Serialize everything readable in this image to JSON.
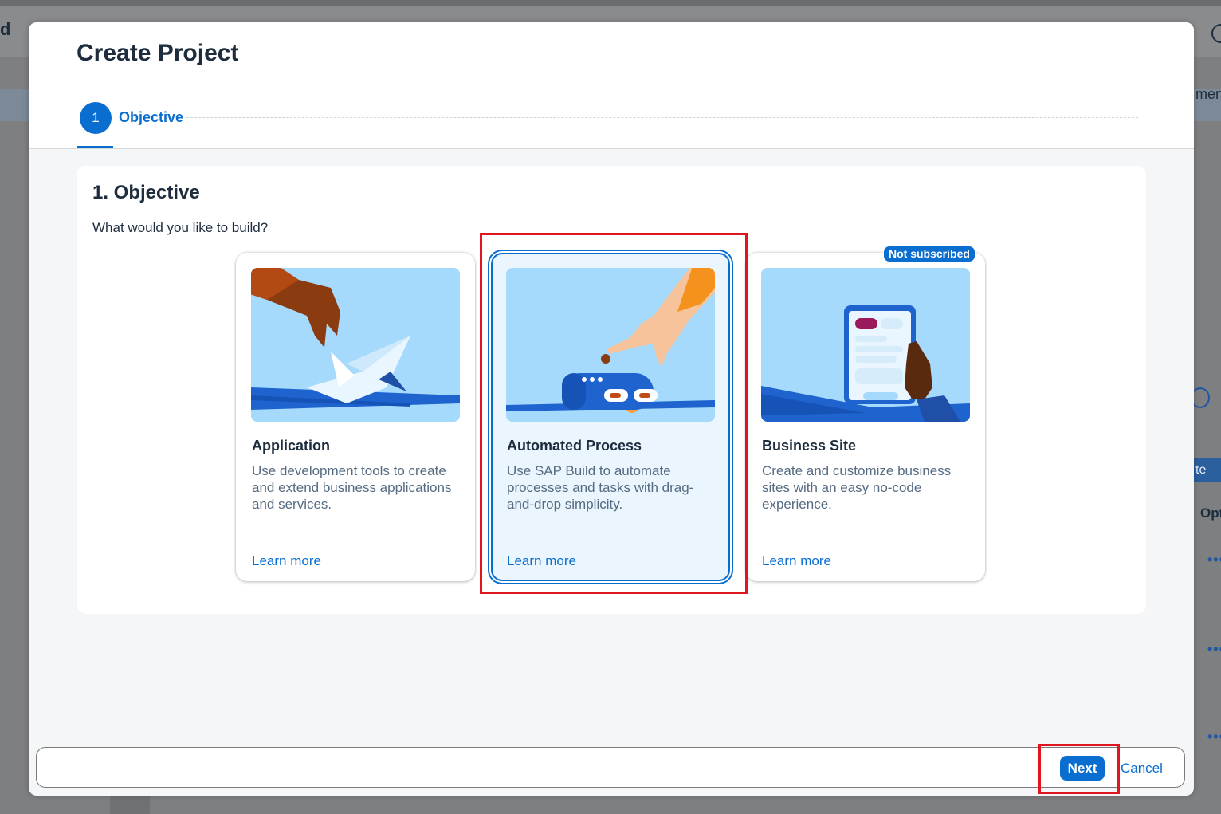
{
  "background": {
    "app_title_fragment": "d",
    "right_text_fragment": "men",
    "right_button_fragment": "te",
    "right_column_fragment": "Opt",
    "row_menu": "•••"
  },
  "modal": {
    "title": "Create Project",
    "steps": [
      {
        "number": "1",
        "label": "Objective"
      }
    ],
    "section_title": "1. Objective",
    "question": "What would you like to build?",
    "cards": [
      {
        "title": "Application",
        "description": "Use development tools to create and extend business applications and services.",
        "link": "Learn more",
        "selected": false
      },
      {
        "title": "Automated Process",
        "description": "Use SAP Build to automate processes and tasks with drag-and-drop simplicity.",
        "link": "Learn more",
        "selected": true
      },
      {
        "title": "Business Site",
        "description": "Create and customize business sites with an easy no-code experience.",
        "link": "Learn more",
        "selected": false,
        "badge": "Not subscribed"
      }
    ],
    "footer": {
      "next_label": "Next",
      "cancel_label": "Cancel"
    }
  },
  "colors": {
    "accent": "#0a6ed1",
    "highlight": "#e0161e",
    "text": "#1d2d3e"
  }
}
